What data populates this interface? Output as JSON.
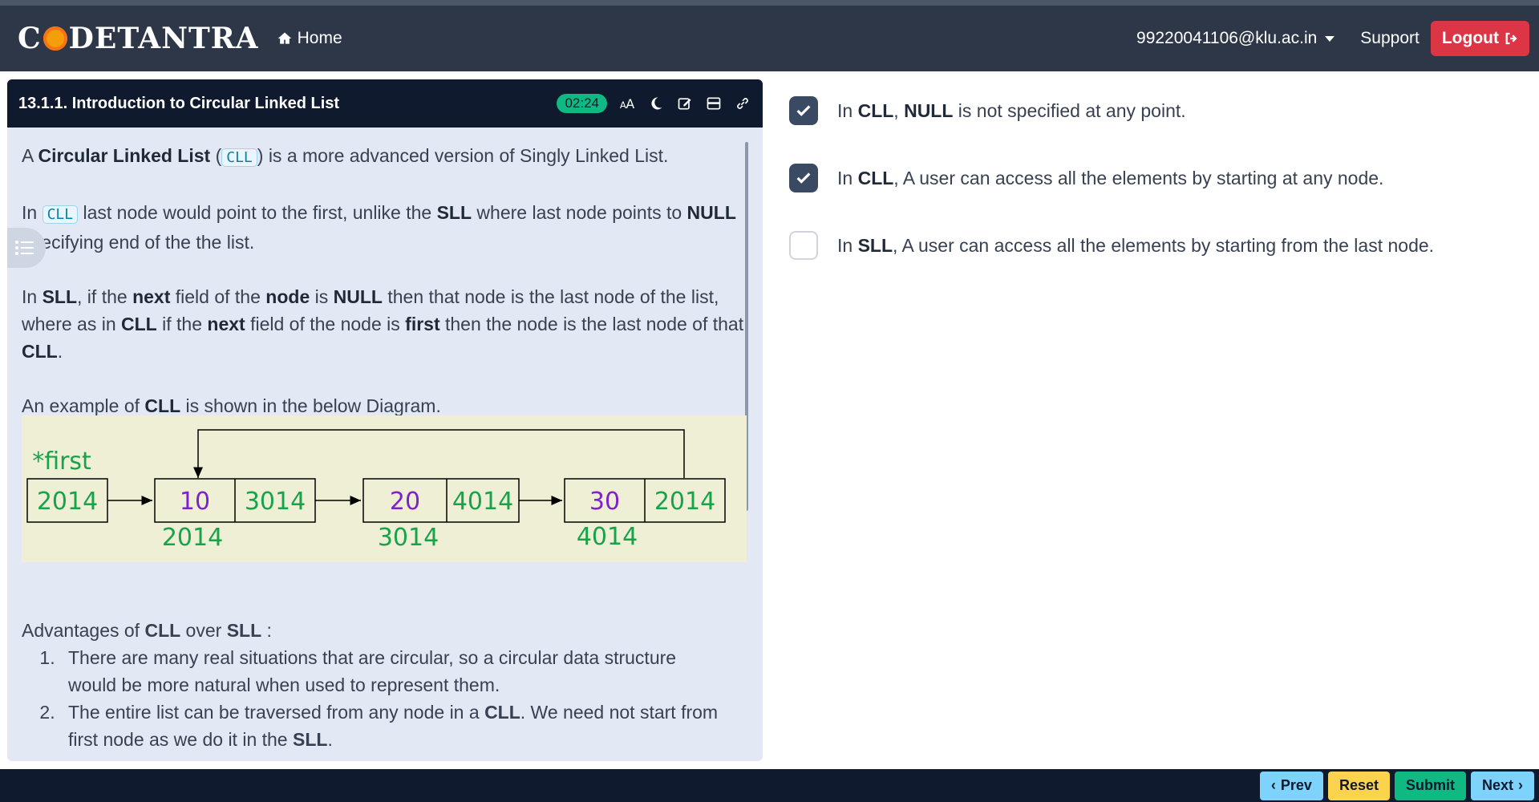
{
  "navbar": {
    "brand_left": "C",
    "brand_right": "DETANTRA",
    "home_label": "Home",
    "user_email": "99220041106@klu.ac.in",
    "support_label": "Support",
    "logout_label": "Logout"
  },
  "lesson": {
    "title": "13.1.1. Introduction to Circular Linked List",
    "timer": "02:24",
    "p1": {
      "a": "A ",
      "b": "Circular Linked List",
      "c": " (",
      "code": "CLL",
      "d": ") is a more advanced version of Singly Linked List."
    },
    "p2": {
      "a": "In ",
      "code": "CLL",
      "b": " last node would point to the first, unlike the ",
      "c": "SLL",
      "d": " where last node points to ",
      "e": "NULL",
      "f": " specifying end of the the list."
    },
    "p3": {
      "a": "In ",
      "b": "SLL",
      "c": ", if the ",
      "d": "next",
      "e": " field of the ",
      "f": "node",
      "g": " is ",
      "h": "NULL",
      "i": " then that node is the last node of the list, where as in ",
      "j": "CLL",
      "k": " if the ",
      "l": "next",
      "m": " field of the node is ",
      "n": "first",
      "o": " then the node is the last node of that ",
      "p": "CLL",
      "q": "."
    },
    "p4": {
      "a": "An example of ",
      "b": "CLL",
      "c": " is shown in the below Diagram."
    },
    "diagram": {
      "pointer_label": "*first",
      "head_value": "2014",
      "nodes": [
        {
          "data": "10",
          "next": "3014",
          "address": "2014"
        },
        {
          "data": "20",
          "next": "4014",
          "address": "3014"
        },
        {
          "data": "30",
          "next": "2014",
          "address": "4014"
        }
      ]
    },
    "advantages": {
      "a": "Advantages of ",
      "b": "CLL",
      "c": " over ",
      "d": "SLL",
      "e": " :",
      "item1": "There are many real situations that are circular, so a circular data structure would be more natural when used to represent them.",
      "item2": {
        "a": "The entire list can be traversed from any node in a ",
        "b": "CLL",
        "c": ". We need not start from first node as we do it in the ",
        "d": "SLL",
        "e": "."
      }
    }
  },
  "options": [
    {
      "a": "In ",
      "b": "CLL",
      "c": ", ",
      "d": "NULL",
      "e": " is not specified at any point.",
      "checked": true
    },
    {
      "a": "In ",
      "b": "CLL",
      "c": ", A user can access all the elements by starting at any node.",
      "checked": true
    },
    {
      "a": "In ",
      "b": "SLL",
      "c": ", A user can access all the elements by starting from the last node.",
      "checked": false
    }
  ],
  "footer": {
    "prev_label": "Prev",
    "reset_label": "Reset",
    "submit_label": "Submit",
    "next_label": "Next"
  },
  "colors": {
    "navbar_bg": "#2d3748",
    "logout_bg": "#dc3545",
    "panel_header_bg": "#0f1a2e",
    "timer_bg": "#10b981",
    "checkbox_checked": "#3b4a63",
    "diagram_green": "#16a34a",
    "diagram_purple": "#7e22ce"
  }
}
